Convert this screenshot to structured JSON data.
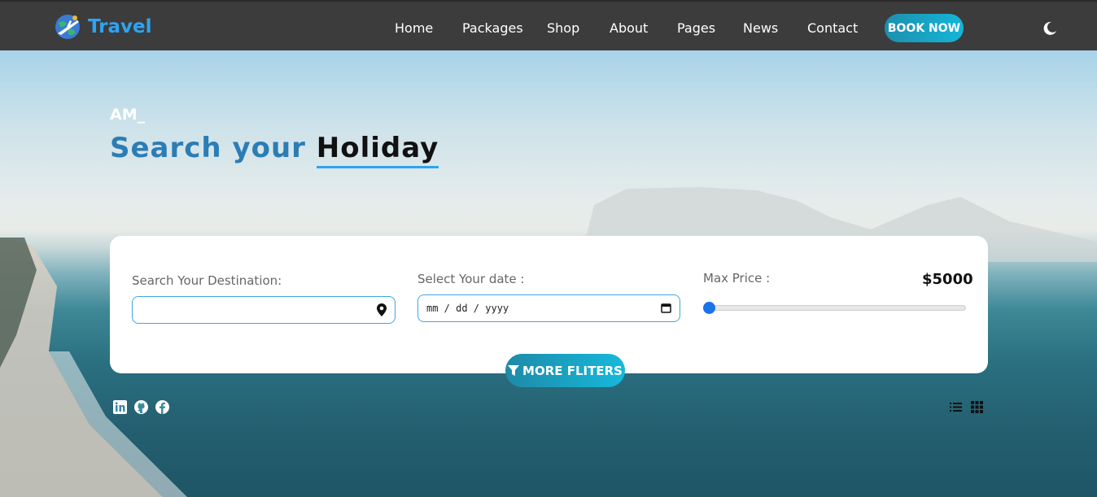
{
  "brand": {
    "name": "Travel"
  },
  "nav": {
    "items": [
      "Home",
      "Packages",
      "Shop",
      "About",
      "Pages",
      "News",
      "Contact"
    ],
    "book_label": "BOOK NOW"
  },
  "hero": {
    "greeting": "AM_",
    "headline_part1": "Search your",
    "headline_part2": "Holiday"
  },
  "search": {
    "destination_label": "Search Your Destination:",
    "destination_value": "",
    "date_label": "Select Your date :",
    "date_placeholder": "mm / dd / yyyy",
    "price_label": "Max Price :",
    "price_value": "$5000",
    "price_slider_fraction": 0.0,
    "more_filters_label": "MORE FLITERS"
  },
  "icons": {
    "logo": "globe-plane-icon",
    "theme": "moon-icon",
    "location": "map-pin-icon",
    "calendar": "calendar-icon",
    "filter": "filter-icon",
    "social": [
      "linkedin-icon",
      "github-icon",
      "facebook-icon"
    ],
    "views": [
      "list-view-icon",
      "grid-view-icon"
    ]
  },
  "colors": {
    "brand": "#2ea3f2",
    "accent": "#16b9db",
    "topbar": "#3c3c3c"
  }
}
